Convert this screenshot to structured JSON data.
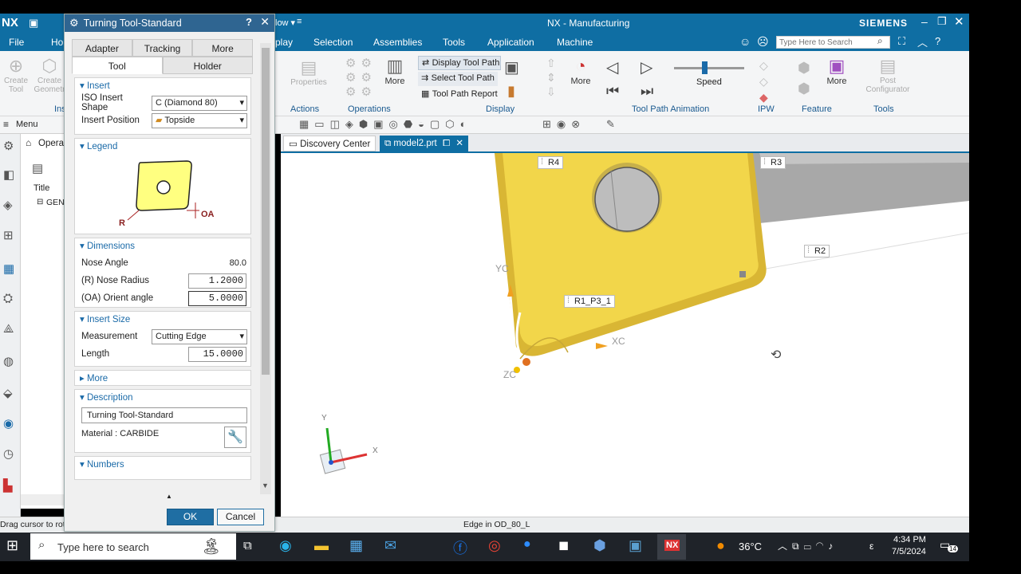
{
  "app": {
    "logo": "NX",
    "title": "NX - Manufacturing",
    "brand": "SIEMENS",
    "window_dropdown": "low ▾",
    "search_placeholder": "Type Here to Search"
  },
  "ribbon_tabs": [
    "File",
    "Ho",
    "play",
    "Selection",
    "Assemblies",
    "Tools",
    "Application",
    "Machine"
  ],
  "ribbon": {
    "create_tool": "Create Tool",
    "create_geometry": "Create Geometr",
    "ins": "Ins",
    "properties": "Properties",
    "actions": "Actions",
    "operations": "Operations",
    "more1": "More",
    "display_tool_path": "Display Tool Path",
    "select_tool_path": "Select Tool Path",
    "tool_path_report": "Tool Path Report",
    "display": "Display",
    "more2": "More",
    "speed": "Speed",
    "tool_path_animation": "Tool Path Animation",
    "ipw": "IPW",
    "more3": "More",
    "feature": "Feature",
    "post_configurator": "Post Configurator",
    "tools": "Tools"
  },
  "toolbar2": {
    "menu": "Menu"
  },
  "navpanel": {
    "header": "Operat",
    "title_col": "Title",
    "gen": "GEN"
  },
  "doc_tabs": {
    "discovery": "Discovery Center",
    "model": "model2.prt"
  },
  "dialog": {
    "title": "Turning Tool-Standard",
    "tabs1": [
      "Adapter",
      "Tracking",
      "More"
    ],
    "tabs2": [
      "Tool",
      "Holder"
    ],
    "insert": {
      "header": "Insert",
      "iso_label": "ISO Insert Shape",
      "iso_value": "C (Diamond 80)",
      "pos_label": "Insert Position",
      "pos_value": "Topside"
    },
    "legend": {
      "header": "Legend",
      "r": "R",
      "oa": "OA"
    },
    "dimensions": {
      "header": "Dimensions",
      "nose_angle_label": "Nose Angle",
      "nose_angle_value": "80.0",
      "nose_radius_label": "(R) Nose Radius",
      "nose_radius_value": "1.2000",
      "orient_label": "(OA) Orient angle",
      "orient_value": "5.0000"
    },
    "insert_size": {
      "header": "Insert Size",
      "measurement_label": "Measurement",
      "measurement_value": "Cutting Edge",
      "length_label": "Length",
      "length_value": "15.0000"
    },
    "more_header": "More",
    "description": {
      "header": "Description",
      "value": "Turning Tool-Standard",
      "material": "Material : CARBIDE"
    },
    "numbers_header": "Numbers",
    "ok": "OK",
    "cancel": "Cancel"
  },
  "viewport": {
    "labels": [
      "R4",
      "R3",
      "R2",
      "R1_P3_1"
    ],
    "axes": {
      "yc": "YC",
      "xc": "XC",
      "zc": "ZC",
      "y": "Y",
      "x": "X"
    }
  },
  "status": {
    "left": "Drag cursor to rota",
    "center": "Edge in OD_80_L"
  },
  "taskbar": {
    "search": "Type here to search",
    "weather": "36°C",
    "time": "4:34 PM",
    "date": "7/5/2024",
    "notifications": "14"
  },
  "colors": {
    "accent": "#0f6ea3",
    "insert_yellow": "#f2d64a",
    "dialog_title": "#2f6591"
  }
}
